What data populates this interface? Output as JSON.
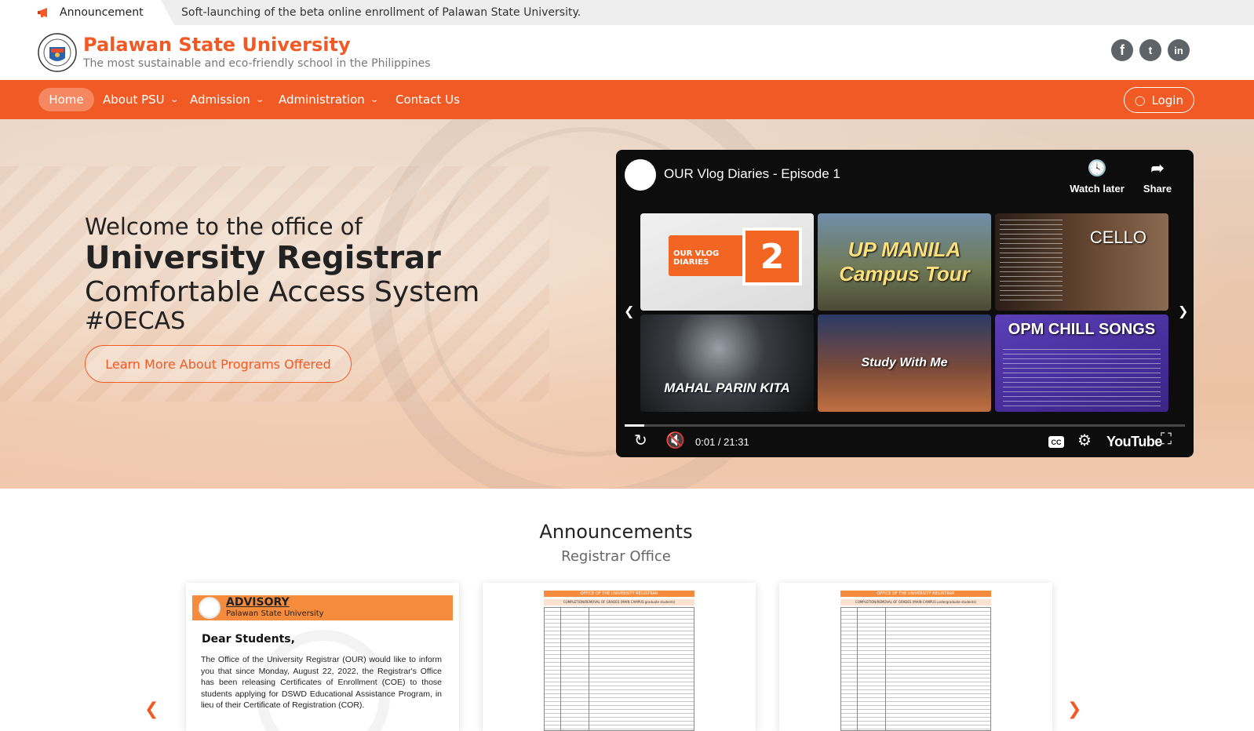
{
  "announcement_bar": {
    "tag_label": "Announcement",
    "text": "Soft-launching of the beta online enrollment of Palawan State University."
  },
  "header": {
    "brand_name": "Palawan State University",
    "tagline": "The most sustainable and eco-friendly school in the Philippines",
    "social": [
      {
        "icon": "facebook-icon",
        "glyph": "f"
      },
      {
        "icon": "twitter-icon",
        "glyph": "t"
      },
      {
        "icon": "linkedin-icon",
        "glyph": "in"
      }
    ]
  },
  "nav": {
    "items": [
      {
        "label": "Home",
        "active": true
      },
      {
        "label": "About PSU",
        "dropdown": true
      },
      {
        "label": "Admission",
        "dropdown": true
      },
      {
        "label": "Administration",
        "dropdown": true
      },
      {
        "label": "Contact Us"
      }
    ],
    "login_label": "Login"
  },
  "hero": {
    "line1": "Welcome to the office of",
    "line2": "University Registrar",
    "line3": "Comfortable Access System",
    "line4": "#OECAS",
    "cta_label": "Learn More About Programs Offered"
  },
  "video": {
    "title": "OUR Vlog Diaries - Episode 1",
    "watch_later": "Watch later",
    "share": "Share",
    "time": "0:01 / 21:31",
    "progress": 0.035,
    "brand": "YouTube",
    "cc": "CC",
    "thumbnails": [
      {
        "caption": "OUR VLOG DIARIES",
        "number": "2"
      },
      {
        "caption": "UP MANILA Campus Tour"
      },
      {
        "caption": "CELLO"
      },
      {
        "caption": "MAHAL PARIN KITA"
      },
      {
        "caption": "Study With Me"
      },
      {
        "caption": "OPM CHILL SONGS"
      }
    ]
  },
  "announcements": {
    "title": "Announcements",
    "subtitle": "Registrar Office",
    "advisory": {
      "title": "ADVISORY",
      "org": "Palawan State University",
      "greeting": "Dear Students,",
      "body": "The Office of the University Registrar (OUR) would like to inform you that since Monday, August 22, 2022, the Registrar's Office has been releasing Certificates of Enrollment (COE) to those students applying for DSWD Educational Assistance Program, in lieu of their Certificate of Registration (COR)."
    },
    "doc_cards": [
      {
        "header": "OFFICE OF THE UNIVERSITY REGISTRAR",
        "subheader": "COMPLETION/REMOVAL OF GRADES (MAIN CAMPUS graduate students)"
      },
      {
        "header": "OFFICE OF THE UNIVERSITY REGISTRAR",
        "subheader": "COMPLETION/REMOVAL OF GRADES (MAIN CAMPUS undergraduate students)"
      }
    ]
  }
}
